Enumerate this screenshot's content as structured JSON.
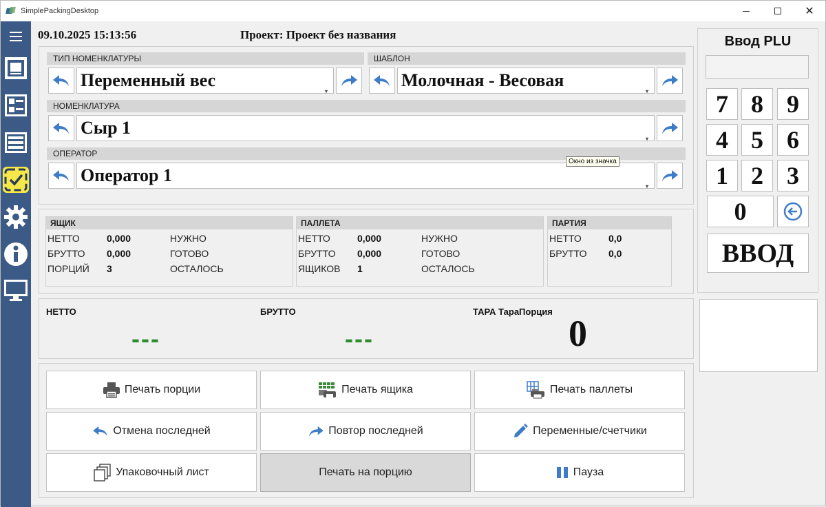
{
  "window": {
    "title": "SimplePackingDesktop"
  },
  "header": {
    "datetime": "09.10.2025 15:13:56",
    "project": "Проект: Проект без названия"
  },
  "sidebar": {
    "items": [
      {
        "icon": "menu-icon"
      },
      {
        "icon": "window-icon"
      },
      {
        "icon": "list-details-icon"
      },
      {
        "icon": "table-icon"
      },
      {
        "icon": "task-check-icon",
        "active": true
      },
      {
        "icon": "gear-icon"
      },
      {
        "icon": "info-icon"
      },
      {
        "icon": "monitor-icon"
      }
    ]
  },
  "fields": {
    "nomenclature_type": {
      "label": "ТИП НОМЕНКЛАТУРЫ",
      "value": "Переменный вес"
    },
    "template": {
      "label": "ШАБЛОН",
      "value": "Молочная - Весовая"
    },
    "nomenclature": {
      "label": "НОМЕНКЛАТУРА",
      "value": "Сыр 1"
    },
    "operator": {
      "label": "ОПЕРАТОР",
      "value": "Оператор 1"
    }
  },
  "tooltip": "Окно из значка",
  "counters": {
    "box": {
      "title": "ЯЩИК",
      "rows": [
        {
          "label": "НЕТТО",
          "value": "0,000",
          "status": "НУЖНО"
        },
        {
          "label": "БРУТТО",
          "value": "0,000",
          "status": "ГОТОВО"
        },
        {
          "label": "ПОРЦИЙ",
          "value": "3",
          "status": "ОСТАЛОСЬ"
        }
      ]
    },
    "pallet": {
      "title": "ПАЛЛЕТА",
      "rows": [
        {
          "label": "НЕТТО",
          "value": "0,000",
          "status": "НУЖНО"
        },
        {
          "label": "БРУТТО",
          "value": "0,000",
          "status": "ГОТОВО"
        },
        {
          "label": "ЯЩИКОВ",
          "value": "1",
          "status": "ОСТАЛОСЬ"
        }
      ]
    },
    "batch": {
      "title": "ПАРТИЯ",
      "rows": [
        {
          "label": "НЕТТО",
          "value": "0,0"
        },
        {
          "label": "БРУТТО",
          "value": "0,0"
        }
      ]
    }
  },
  "weights": {
    "netto": {
      "label": "НЕТТО",
      "value": "---"
    },
    "brutto": {
      "label": "БРУТТО",
      "value": "---"
    },
    "tara": {
      "label": "ТАРА ТараПорция",
      "value": "0"
    }
  },
  "actions": {
    "print_portion": "Печать порции",
    "print_box": "Печать ящика",
    "print_pallet": "Печать паллеты",
    "undo_last": "Отмена последней",
    "repeat_last": "Повтор последней",
    "variables": "Переменные/счетчики",
    "packing_list": "Упаковочный лист",
    "print_on_portion": "Печать на порцию",
    "pause": "Пауза"
  },
  "plu": {
    "title": "Ввод PLU",
    "display": "",
    "keys": [
      "7",
      "8",
      "9",
      "4",
      "5",
      "6",
      "1",
      "2",
      "3",
      "0"
    ],
    "enter": "ВВОД"
  },
  "colors": {
    "sidebar": "#3b5a86",
    "active_icon": "#f6e84a",
    "arrow": "#3f7cc7",
    "weight_green": "#2e8b2e"
  }
}
